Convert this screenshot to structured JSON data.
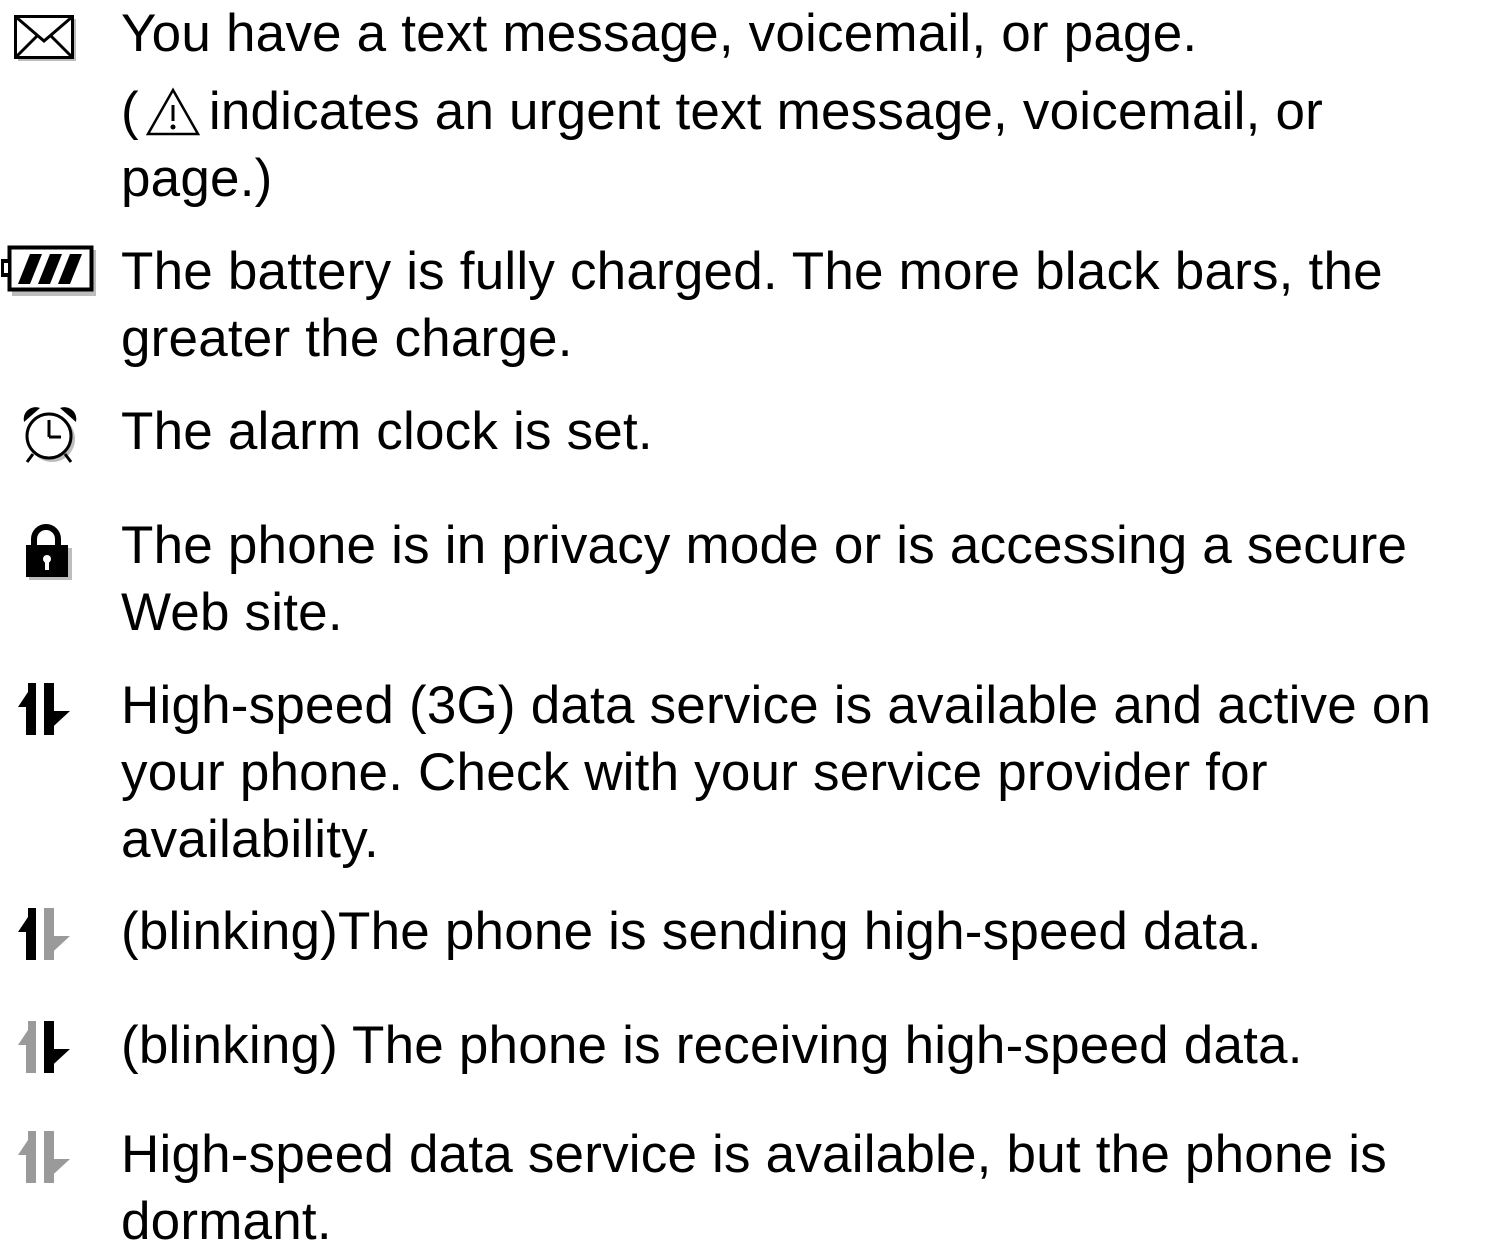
{
  "icons": {
    "message": "envelope-icon",
    "battery": "battery-full-icon",
    "alarm": "alarm-clock-icon",
    "privacy": "padlock-icon",
    "data_active": "data-active-arrows-icon",
    "data_sending": "data-sending-arrows-icon",
    "data_receiving": "data-receiving-arrows-icon",
    "data_dormant": "data-dormant-arrows-icon",
    "urgent": "warning-triangle-icon"
  },
  "colors": {
    "icon_active": "#000000",
    "icon_inactive": "#9a9a9a",
    "text": "#000000"
  },
  "entries": {
    "message": {
      "line1": "You have a text message, voicemail, or page.",
      "line2_open": "(",
      "line2_rest": "indicates an urgent text message, voicemail, or",
      "line3": "page.)"
    },
    "battery": {
      "line1": "The battery is fully charged. The more black bars, the",
      "line2": "greater the charge."
    },
    "alarm": {
      "line1": "The alarm clock is set."
    },
    "privacy": {
      "line1": "The phone is in privacy mode or is accessing a secure",
      "line2": "Web site."
    },
    "data_active": {
      "line1": "High-speed (3G) data service is available and active on",
      "line2": "your phone. Check with your service provider for",
      "line3": "availability."
    },
    "data_sending": {
      "line1": "(blinking)The phone is sending high-speed data."
    },
    "data_receiving": {
      "line1": "(blinking) The phone is receiving high-speed data."
    },
    "data_dormant": {
      "line1": "High-speed data service is available, but the phone is",
      "line2": "dormant."
    }
  }
}
